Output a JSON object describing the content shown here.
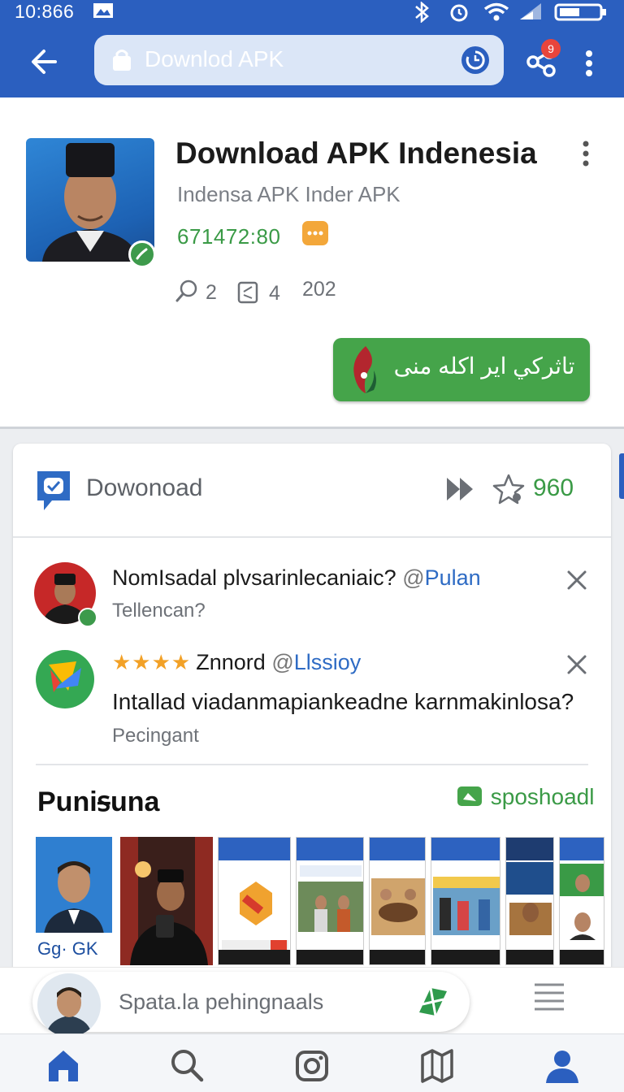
{
  "status_bar": {
    "time": "10:866"
  },
  "toolbar": {
    "url_text": "Downlod APK",
    "notification_count": "9"
  },
  "app": {
    "title": "Download APK Indenesia",
    "subtitle": "Indensa APK Inder APK",
    "number": "671472:80",
    "stats": {
      "replies": "2",
      "shares": "4",
      "count": "202"
    },
    "install_label": "تاثرکي اير اكله منى"
  },
  "panel": {
    "title": "Dowonoad",
    "rating_count": "960",
    "comments": [
      {
        "title": "NomIsadal plvsarinlecaniaic?",
        "at": "@",
        "handle": "Pulan",
        "subtitle": "Tellencan?"
      },
      {
        "stars": "★★★★",
        "author": "Znnord",
        "at": "@",
        "handle": "Llssioy",
        "body": "Intallad viadanmapiankeadne karnmakinlosa?",
        "subtitle": "Pecingant"
      }
    ],
    "section_title": "Puniꟊuna",
    "section_link": "sposhoadl",
    "gallery_caption": "Gg· GK"
  },
  "search": {
    "placeholder": "Spata.la pehingnaals"
  },
  "colors": {
    "primary": "#2b5fbf",
    "green": "#45a44a",
    "accent_orange": "#f3a73a",
    "badge_red": "#e8453c"
  },
  "nav": [
    "home-icon",
    "search-icon",
    "camera-icon",
    "map-icon",
    "profile-icon"
  ]
}
